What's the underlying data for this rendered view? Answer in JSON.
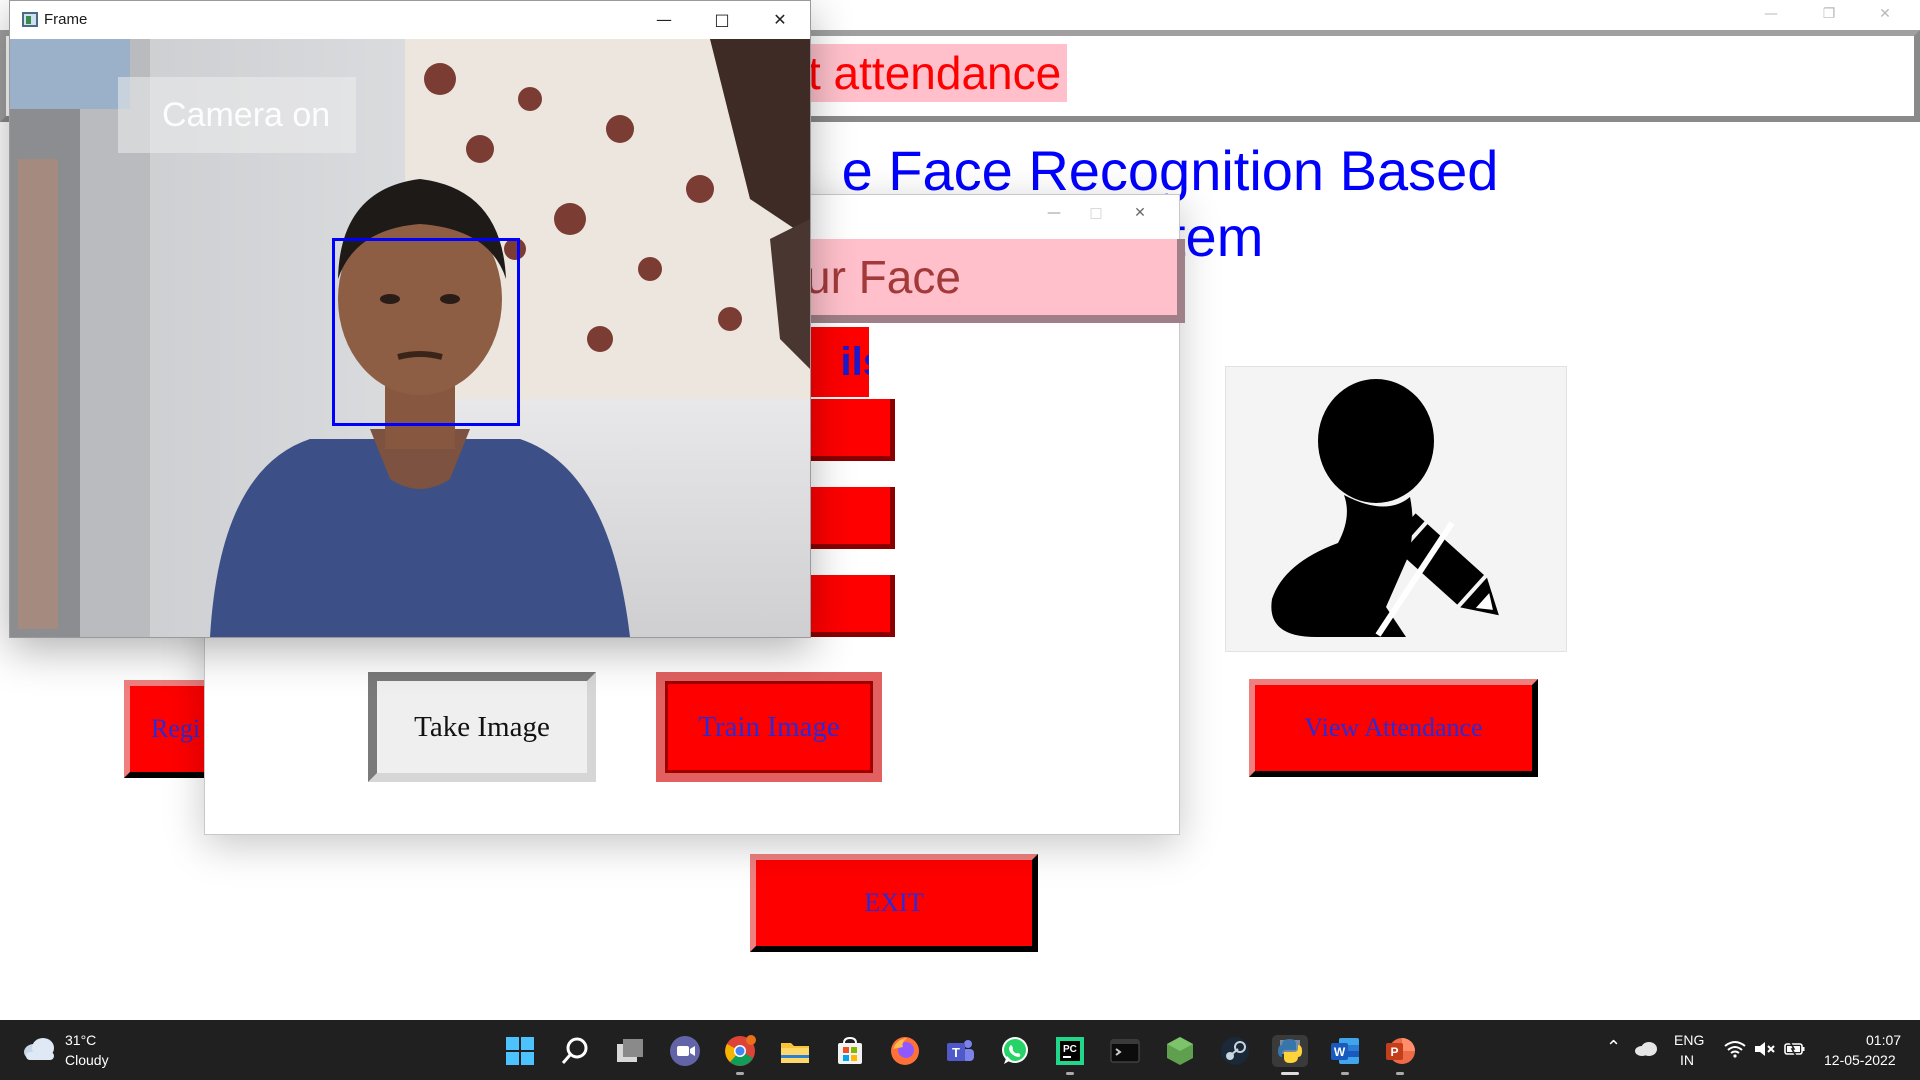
{
  "main_window": {
    "header_label": "t attendance",
    "title": "e Face Recognition Based\n System",
    "view_attendance_label": "View Attendance",
    "exit_label": "EXIT",
    "register_label": "Regi",
    "profile_icon": "user-edit-icon"
  },
  "register_dialog": {
    "heading_partial": "ur Face",
    "subheading_partial": "ils",
    "take_image_label": "Take Image",
    "train_image_label": "Train Image"
  },
  "frame_window": {
    "title": "Frame",
    "camera_label": "Camera on"
  },
  "taskbar": {
    "weather_temp": "31°C",
    "weather_desc": "Cloudy",
    "lang_top": "ENG",
    "lang_bottom": "IN",
    "time": "01:07",
    "date": "12-05-2022",
    "apps": [
      "windows-start",
      "search",
      "task-view",
      "teams-meet",
      "chrome",
      "file-explorer",
      "microsoft-store",
      "firefox",
      "teams",
      "whatsapp",
      "pycharm",
      "terminal",
      "node",
      "steam",
      "python",
      "word",
      "powerpoint"
    ]
  },
  "colors": {
    "button_red": "#ff0000",
    "title_blue": "#0000ff",
    "header_pink": "#ffc0cb"
  }
}
